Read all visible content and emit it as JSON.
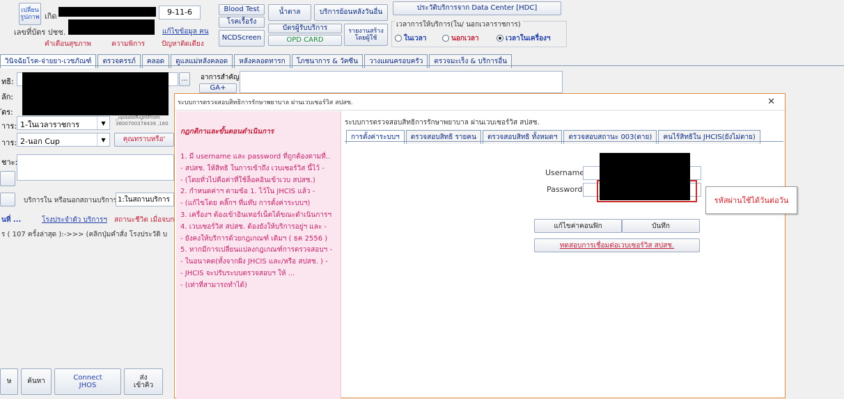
{
  "patient": {
    "change_photo": "เปลี่ยน\nรูปภาพ",
    "born_label": "เกิด",
    "id_card_label": "เลขที่บัตร ปชช.",
    "age_value": "9-11-6",
    "edit_info": "แก้ไขข้อมูล คน",
    "health_warning": "คำเตือนสุขภาพ",
    "disability": "ความพิการ",
    "bedridden": "ปัญหาติดเตียง"
  },
  "top_buttons": {
    "blood_test": "Blood Test",
    "chronic": "โรคเรื้อรัง",
    "ncdscreen": "NCDScreen",
    "weight": "น้ำตาล",
    "provider_card": "บัตรผู้รับบริการ",
    "opd_card": "OPD CARD",
    "service_after": "บริการย้อนหลังวันอื่น",
    "report": "รายงานสร้าง\nโดยผู้ใช้",
    "hdc": "ประวัติบริการจาก Data Center [HDC]"
  },
  "time_group": {
    "label": "เวลาการให้บริการ(ใน/ นอกเวลาราชการ)",
    "options": [
      "ในเวลา",
      "นอกเวลา",
      "เวลาในเครื่องฯ"
    ],
    "selected": 2
  },
  "main_tabs": [
    "วินิจฉัยโรค-จ่ายยา-เวชภัณฑ์",
    "ตรวจครรภ์",
    "คลอด",
    "ดูแลแม่หลังคลอด",
    "หลังคลอดทารก",
    "โภชนาการ & วัคซีน",
    "วางแผนครอบครัว",
    "ตรวจมะเร็ง & บริการอื่น"
  ],
  "left_form": {
    "lbl_right": "ทธิ:",
    "lbl_hosp": "ลัก:",
    "lbl_card": "ัตร:",
    "lbl_service_time": "าาร:",
    "service_time_value": "1-ในเวลาราชการ",
    "lbl_service_type": "าาร:",
    "service_type_value": "2-นอก Cup",
    "lbl_note": "ชาะ:",
    "update_text": "_updateRightFrom\n3600700378439 ,160",
    "know_btn": "คุณทราบหรือ'",
    "ellipsis": "...",
    "symptom_label": "อาการสำคัญ:",
    "ga_btn": "GA+",
    "service_place_label": "บริการใน หรือนอกสถานบริการ:",
    "service_place_value": "1:ในสถานบริการ",
    "history_links": [
      "นที่ ...",
      "โรงประจำตัว บริการฯ",
      "สถานะชีวิต เมื่อจบก"
    ],
    "history_text": "ร ( 107 ครั้งล่าสุด ):->>> (คลิกปุ่มคำสั่ง โรงประวัติ บ"
  },
  "bottom_buttons": [
    "ษ",
    "ค้นหา",
    "Connect\nJHOS",
    "ส่ง\nเข้าคิว"
  ],
  "dialog": {
    "title": "ระบบการตรวจสอบสิทธิการรักษาพยาบาล ผ่านเวบเซอร์วิส สปสช.",
    "close": "✕",
    "rules_heading": "กฎกติกาและขั้นตอนดำเนินการ",
    "rules": [
      "1. มี username และ password ที่ถูกต้องตามที่..",
      "- สปสช. ให้สิทธิ ในการเข้าถึง เวบเซอร์วิส นี้ไว้ -",
      "- (โดยทั่วไปคือค่าที่ใช้ล็อคอินเข้าเวบ สปสช.)",
      "2. กำหนดค่าฯ ตามข้อ 1. ไว้ใน JHCIS แล้ว -",
      "- (แก้ไขโดย คลิ๊กฯ ที่แท๊บ การตั้งค่าระบบฯ)",
      "3. เครื่องฯ ต้องเข้าอินเทอร์เน็ตได้ขณะดำเนินการฯ",
      "4. เวบเซอร์วิส สปสช. ต้องยังให้บริการอยู่ฯ และ -",
      "- ยังคงให้บริการด้วยกฎเกณฑ์ เดิมฯ ( ธค 2556 )",
      "5. หากมีการเปลี่ยนแปลงกฎเกณฑ์การตรวจสอบฯ -",
      "- ในอนาคต(ทั้งจากฝั่ง JHCIS และ/หรือ สปสช. ) -",
      "- JHCIS จะปรับระบบตรวจสอบฯ ให้ ...",
      "- (เท่าที่สามารถทำได้)"
    ],
    "panel_title": "ระบบการตรวจสอบสิทธิการรักษาพยาบาล ผ่านเวบเซอร์วิส สปสช.",
    "tabs": [
      "การตั้งค่าระบบฯ",
      "ตรวจสอบสิทธิ รายคน",
      "ตรวจสอบสิทธิ ทั้งหมดฯ",
      "ตรวจสอบสถานะ 003(ตาย)",
      "คนไร้สิทธิใน JHCIS(ยังไม่ตาย)"
    ],
    "username_label": "Username:",
    "password_label": "Password:",
    "annotation": "รหัสผ่านใช้ได้วันต่อวัน",
    "edit_btn": "แก้ไขค่าคอนฟิก",
    "save_btn": "บันทึก",
    "test_btn": "ทดสอบการเชื่อมต่อเวบเซอร์วิส สปสช."
  }
}
